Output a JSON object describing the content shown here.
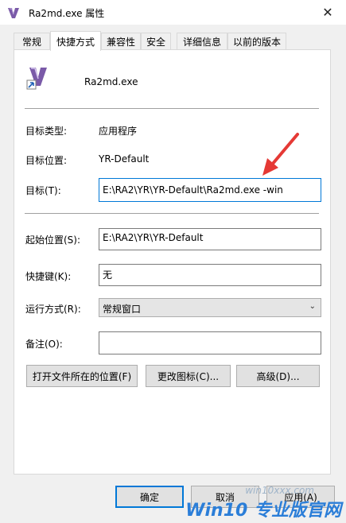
{
  "window": {
    "title": "Ra2md.exe 属性",
    "close_glyph": "✕"
  },
  "tabs": [
    {
      "label": "常规"
    },
    {
      "label": "快捷方式"
    },
    {
      "label": "兼容性"
    },
    {
      "label": "安全"
    },
    {
      "label": "详细信息"
    },
    {
      "label": "以前的版本"
    }
  ],
  "shortcut": {
    "name": "Ra2md.exe",
    "target_type_label": "目标类型:",
    "target_type_value": "应用程序",
    "target_location_label": "目标位置:",
    "target_location_value": "YR-Default",
    "target_label": "目标(T):",
    "target_value": "E:\\RA2\\YR\\YR-Default\\Ra2md.exe -win",
    "start_in_label": "起始位置(S):",
    "start_in_value": "E:\\RA2\\YR\\YR-Default",
    "shortcut_key_label": "快捷键(K):",
    "shortcut_key_value": "无",
    "run_label": "运行方式(R):",
    "run_value": "常规窗口",
    "comment_label": "备注(O):",
    "comment_value": ""
  },
  "buttons": {
    "open_location": "打开文件所在的位置(F)",
    "change_icon": "更改图标(C)...",
    "advanced": "高级(D)...",
    "ok": "确定",
    "cancel": "取消",
    "apply": "应用(A)"
  },
  "watermark": {
    "site": "win10xxx.com",
    "text": "Win10 专业版官网"
  },
  "colors": {
    "accent": "#0078d7",
    "arrow": "#e53935",
    "watermark": "#2b7ed8"
  }
}
